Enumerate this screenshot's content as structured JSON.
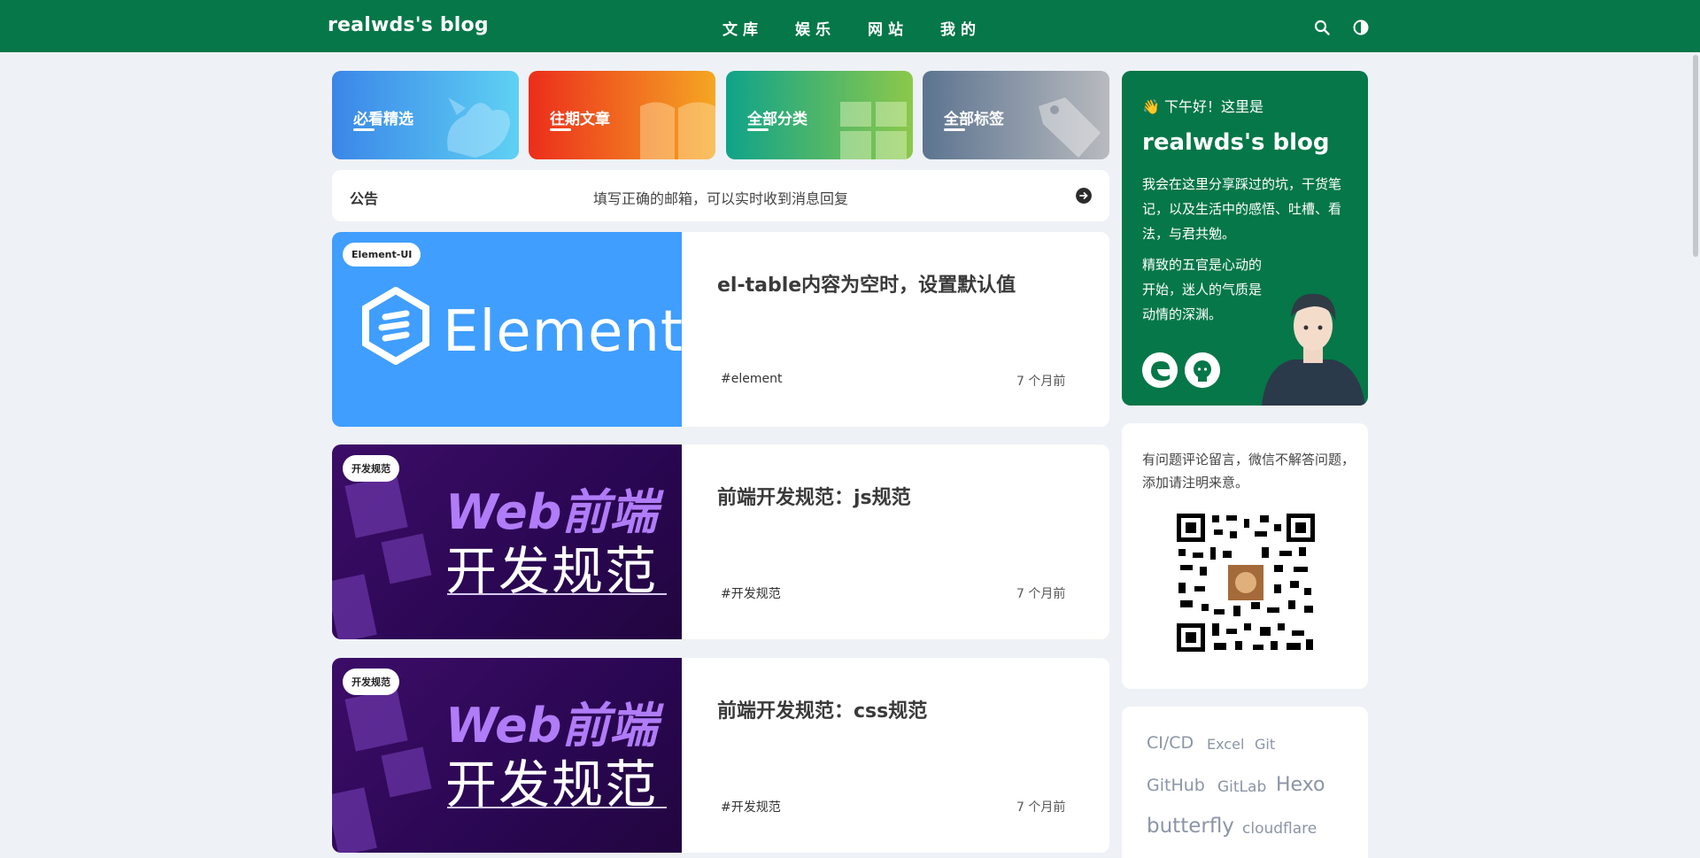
{
  "header": {
    "brand": "realwds's blog",
    "menu": [
      "文库",
      "娱乐",
      "网站",
      "我的"
    ],
    "search_icon": "search-icon",
    "theme_icon": "dark-mode-icon",
    "bg_color": "#057748"
  },
  "categories": [
    {
      "label": "必看精选",
      "icon": "whale-icon"
    },
    {
      "label": "往期文章",
      "icon": "book-icon"
    },
    {
      "label": "全部分类",
      "icon": "grid-icon"
    },
    {
      "label": "全部标签",
      "icon": "tag-icon"
    }
  ],
  "notice": {
    "title": "公告",
    "text": "填写正确的邮箱，可以实时收到消息回复"
  },
  "posts": [
    {
      "badge": "Element-UI",
      "cover_word": "Element",
      "title": "el-table内容为空时，设置默认值",
      "tag": "#element",
      "time": "7 个月前"
    },
    {
      "badge": "开发规范",
      "cover_word1": "Web前端",
      "cover_word2": "开发规范",
      "title": "前端开发规范：js规范",
      "tag": "#开发规范",
      "time": "7 个月前"
    },
    {
      "badge": "开发规范",
      "cover_word1": "Web前端",
      "cover_word2": "开发规范",
      "title": "前端开发规范：css规范",
      "tag": "#开发规范",
      "time": "7 个月前"
    }
  ],
  "author": {
    "hello": "👋 下午好！这里是",
    "name": "realwds's blog",
    "desc": "我会在这里分享踩过的坑，干货笔记，以及生活中的感悟、吐槽、看法，与君共勉。",
    "desc2": "精致的五官是心动的开始，迷人的气质是动情的深渊。",
    "links": [
      "edge-icon",
      "github-icon"
    ]
  },
  "qr_card": {
    "message": "有问题评论留言，微信不解答问题，添加请注明来意。"
  },
  "tag_cloud": [
    "CI/CD",
    "Excel",
    "Git",
    "GitHub",
    "GitLab",
    "Hexo",
    "butterfly",
    "cloudflare"
  ]
}
